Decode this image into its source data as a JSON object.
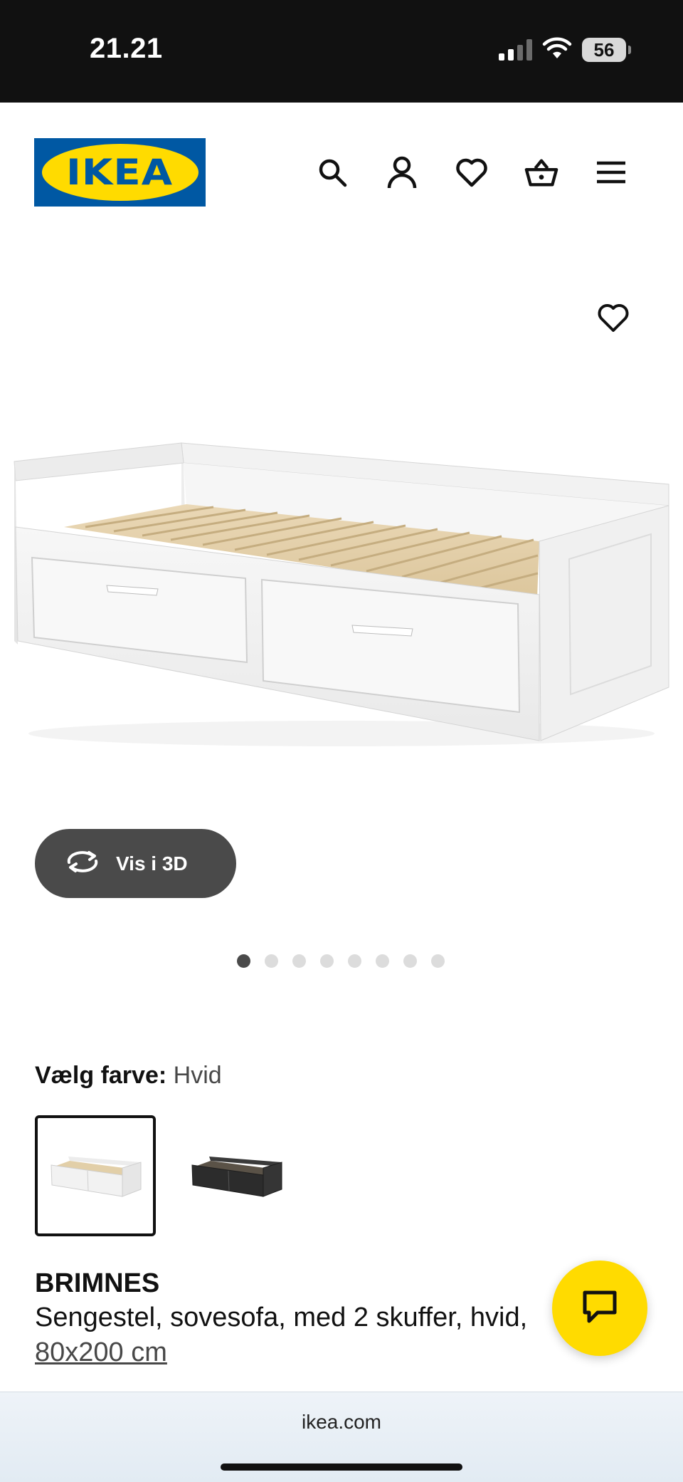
{
  "status_bar": {
    "time": "21.21",
    "battery": "56",
    "icons": [
      "signal-icon",
      "wifi-icon",
      "battery-icon"
    ]
  },
  "header": {
    "logo_text": "IKEA",
    "icons": [
      "search-icon",
      "account-icon",
      "wishlist-heart-icon",
      "cart-basket-icon",
      "menu-icon"
    ]
  },
  "gallery": {
    "favorite_icon": "heart-outline-icon",
    "image_alt": "BRIMNES daybed white",
    "view_3d_label": "Vis i 3D",
    "total_images": 8,
    "active_image_index": 0
  },
  "color_picker": {
    "label": "Vælg farve:",
    "selected": "Hvid",
    "options": [
      {
        "name": "Hvid",
        "selected": true
      },
      {
        "name": "Sort",
        "selected": false
      }
    ]
  },
  "product": {
    "name": "BRIMNES",
    "description": "Sengestel, sovesofa, med 2 skuffer, hvid,",
    "size": "80x200 cm"
  },
  "chat": {
    "icon": "chat-bubble-icon"
  },
  "browser": {
    "url": "ikea.com"
  },
  "colors": {
    "brand_blue": "#0058a3",
    "brand_yellow": "#ffdb00",
    "dark_button": "#4a4a4a"
  }
}
